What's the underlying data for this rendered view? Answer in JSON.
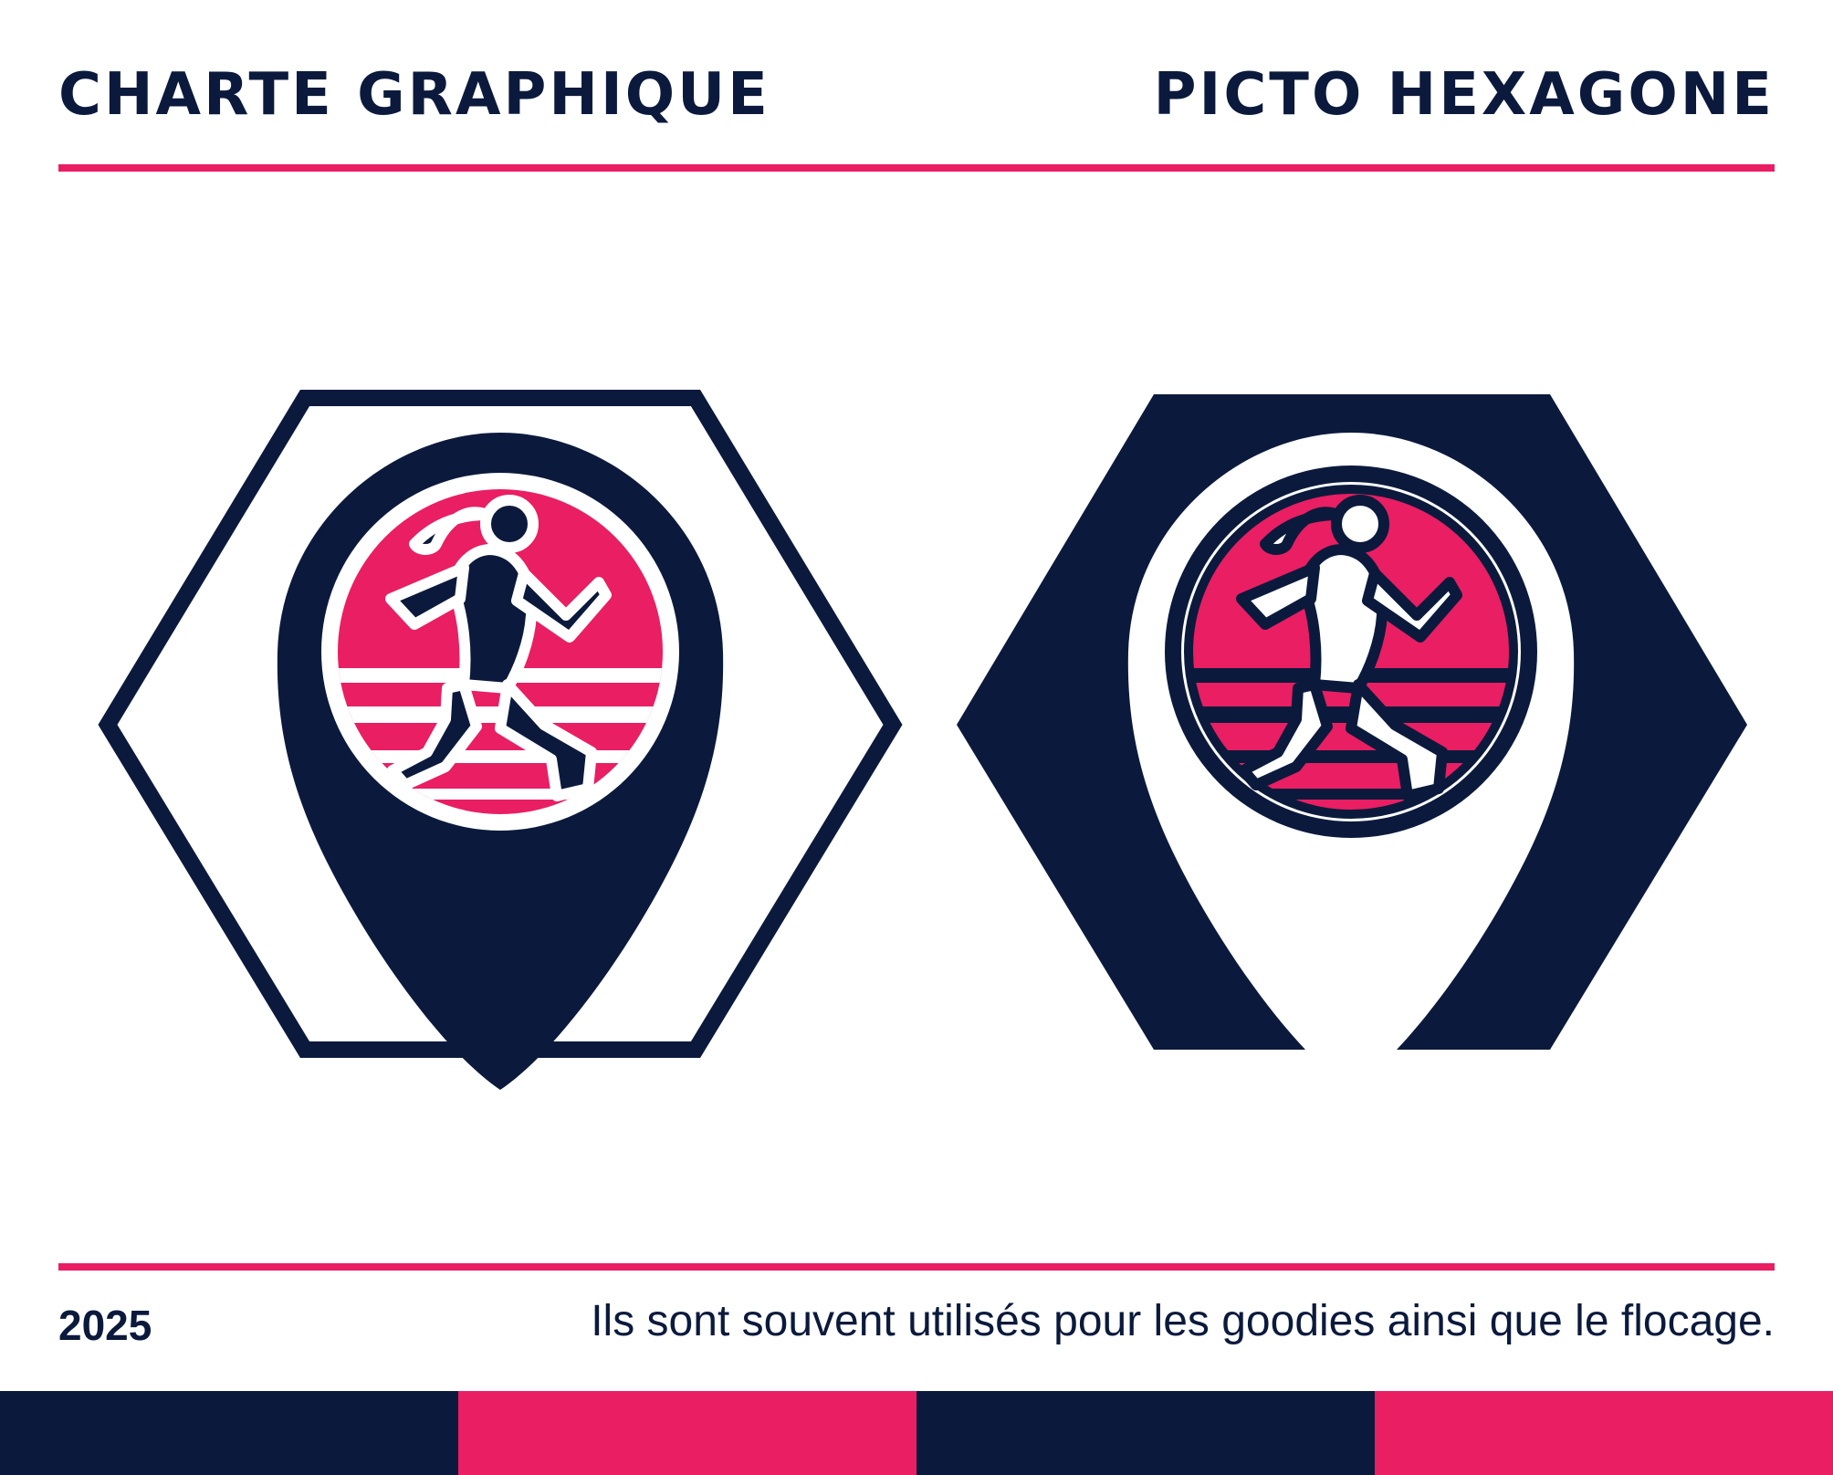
{
  "header": {
    "left_title": "CHARTE GRAPHIQUE",
    "right_title": "PICTO HEXAGONE"
  },
  "footer": {
    "year": "2025",
    "caption": "Ils sont souvent utilisés pour les goodies ainsi que le flocage."
  },
  "colors": {
    "navy": "#0b1a3c",
    "pink": "#e91e63",
    "white": "#ffffff"
  },
  "logos": [
    {
      "variant": "outline-hexagon",
      "icon": "runner-pin-icon"
    },
    {
      "variant": "filled-hexagon",
      "icon": "runner-pin-icon"
    }
  ],
  "bottom_bar": [
    "#0b1a3c",
    "#e91e63",
    "#0b1a3c",
    "#e91e63"
  ]
}
